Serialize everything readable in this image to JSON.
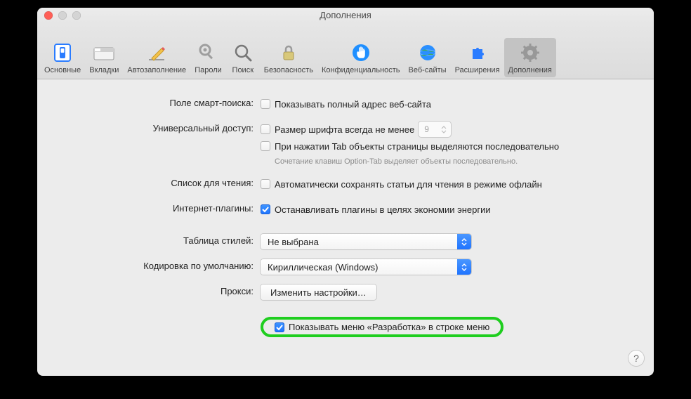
{
  "window": {
    "title": "Дополнения"
  },
  "traffic_lights": {
    "close": true,
    "minimize_enabled": false,
    "zoom_enabled": false
  },
  "toolbar": {
    "selected_index": 9,
    "items": [
      {
        "id": "general",
        "label": "Основные"
      },
      {
        "id": "tabs",
        "label": "Вкладки"
      },
      {
        "id": "autofill",
        "label": "Автозаполнение"
      },
      {
        "id": "passwords",
        "label": "Пароли"
      },
      {
        "id": "search",
        "label": "Поиск"
      },
      {
        "id": "security",
        "label": "Безопасность"
      },
      {
        "id": "privacy",
        "label": "Конфиденциальность"
      },
      {
        "id": "websites",
        "label": "Веб-сайты"
      },
      {
        "id": "extensions",
        "label": "Расширения"
      },
      {
        "id": "advanced",
        "label": "Дополнения"
      }
    ]
  },
  "sections": {
    "smart_search_label": "Поле смарт-поиска:",
    "show_full_address": {
      "checked": false,
      "label": "Показывать полный адрес веб-сайта"
    },
    "accessibility_label": "Универсальный доступ:",
    "min_font_size": {
      "checked": false,
      "label": "Размер шрифта всегда не менее",
      "value": "9"
    },
    "tab_highlight": {
      "checked": false,
      "label": "При нажатии Tab объекты страницы выделяются последовательно"
    },
    "tab_hint": "Сочетание клавиш Option-Tab выделяет объекты последовательно.",
    "reading_list_label": "Список для чтения:",
    "save_offline": {
      "checked": false,
      "label": "Автоматически сохранять статьи для чтения в режиме офлайн"
    },
    "plugins_label": "Интернет-плагины:",
    "stop_plugins": {
      "checked": true,
      "label": "Останавливать плагины в целях экономии энергии"
    },
    "stylesheet_label": "Таблица стилей:",
    "stylesheet_value": "Не выбрана",
    "encoding_label": "Кодировка по умолчанию:",
    "encoding_value": "Кириллическая (Windows)",
    "proxies_label": "Прокси:",
    "proxies_button": "Изменить настройки…",
    "show_develop": {
      "checked": true,
      "label": "Показывать меню «Разработка» в строке меню"
    }
  },
  "help_button": "?"
}
